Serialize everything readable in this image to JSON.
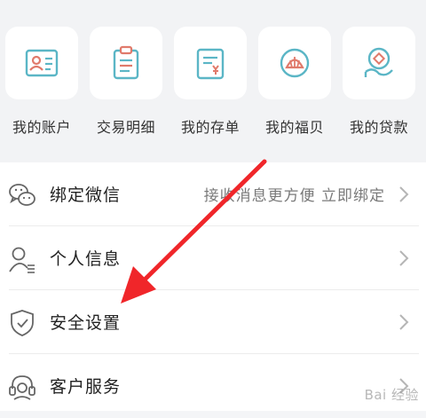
{
  "quick_actions": [
    {
      "label": "我的账户",
      "icon": "id-card-icon"
    },
    {
      "label": "交易明细",
      "icon": "clipboard-icon"
    },
    {
      "label": "我的存单",
      "icon": "deposit-slip-icon"
    },
    {
      "label": "我的福贝",
      "icon": "shell-icon"
    },
    {
      "label": "我的贷款",
      "icon": "hand-coin-icon"
    }
  ],
  "menu": [
    {
      "label": "绑定微信",
      "hint": "接收消息更方便  立即绑定",
      "icon": "wechat-icon"
    },
    {
      "label": "个人信息",
      "hint": "",
      "icon": "user-profile-icon"
    },
    {
      "label": "安全设置",
      "hint": "",
      "icon": "shield-icon"
    },
    {
      "label": "客户服务",
      "hint": "",
      "icon": "headset-icon"
    }
  ],
  "watermark": {
    "text": "Bai 经验"
  },
  "colors": {
    "accent": "#5bb6c6",
    "arrow": "#f0262a"
  }
}
